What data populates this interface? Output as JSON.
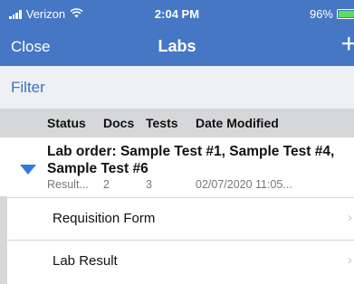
{
  "status_bar": {
    "carrier": "Verizon",
    "time": "2:04 PM",
    "battery": "96%",
    "battery_level": 0.96,
    "battery_color": "#5ddc5d"
  },
  "nav": {
    "close_label": "Close",
    "title": "Labs",
    "add_label": "+",
    "background": "#4577c5"
  },
  "filter": {
    "label": "Filter"
  },
  "columns": [
    "Status",
    "Docs",
    "Tests",
    "Date Modified"
  ],
  "lab_order": {
    "title": "Lab order: Sample Test #1, Sample Test #4, Sample Test #6",
    "status": "Result...",
    "docs": "2",
    "tests": "3",
    "date_modified": "02/07/2020 11:05...",
    "expanded_icon": "triangle-down-icon"
  },
  "children": [
    {
      "label": "Requisition Form",
      "icon": "chevron-right-icon"
    },
    {
      "label": "Lab Result",
      "icon": "chevron-right-icon"
    }
  ]
}
